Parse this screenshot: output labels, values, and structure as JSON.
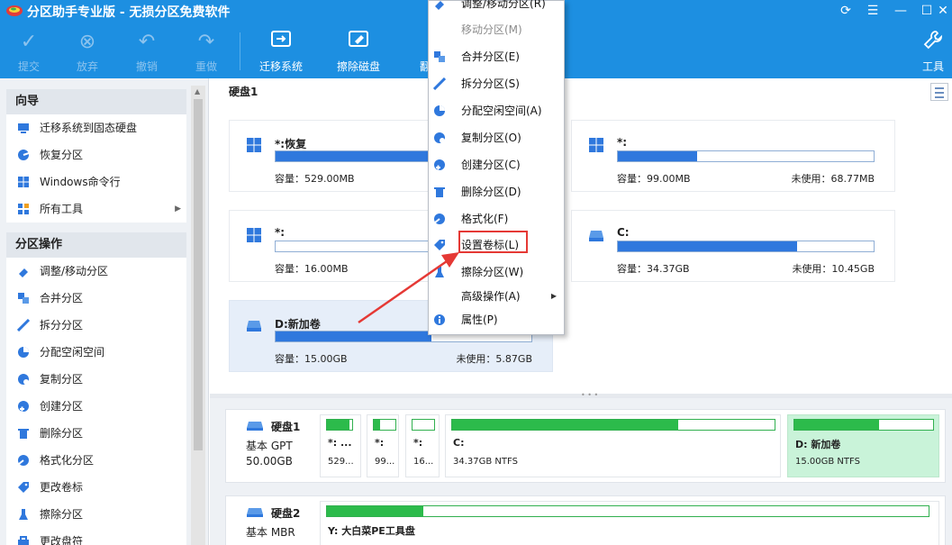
{
  "app": {
    "title": "分区助手专业版 - 无损分区免费软件"
  },
  "toolbar": {
    "buttons": [
      {
        "label": "提交",
        "icon": "check-icon",
        "enabled": false
      },
      {
        "label": "放弃",
        "icon": "cancel-circle-icon",
        "enabled": false
      },
      {
        "label": "撤销",
        "icon": "undo-icon",
        "enabled": false
      },
      {
        "label": "重做",
        "icon": "redo-icon",
        "enabled": false
      },
      {
        "label": "迁移系统",
        "icon": "migrate-os-icon",
        "enabled": true
      },
      {
        "label": "擦除磁盘",
        "icon": "wipe-disk-icon",
        "enabled": true
      },
      {
        "label": "工具",
        "icon": "wrench-icon",
        "enabled": true
      }
    ],
    "partial_label": "翻"
  },
  "sidebar": {
    "wizard_heading": "向导",
    "wizard_items": [
      {
        "label": "迁移系统到固态硬盘",
        "icon": "migrate-icon"
      },
      {
        "label": "恢复分区",
        "icon": "recover-icon"
      },
      {
        "label": "Windows命令行",
        "icon": "windows-icon"
      },
      {
        "label": "所有工具",
        "icon": "grid-icon",
        "has_submenu": true
      }
    ],
    "ops_heading": "分区操作",
    "ops_items": [
      {
        "label": "调整/移动分区",
        "icon": "resize-icon"
      },
      {
        "label": "合并分区",
        "icon": "merge-icon"
      },
      {
        "label": "拆分分区",
        "icon": "split-icon"
      },
      {
        "label": "分配空闲空间",
        "icon": "allocate-icon"
      },
      {
        "label": "复制分区",
        "icon": "copy-icon"
      },
      {
        "label": "创建分区",
        "icon": "create-icon"
      },
      {
        "label": "删除分区",
        "icon": "delete-icon"
      },
      {
        "label": "格式化分区",
        "icon": "format-icon"
      },
      {
        "label": "更改卷标",
        "icon": "label-icon"
      },
      {
        "label": "擦除分区",
        "icon": "wipe-icon"
      },
      {
        "label": "更改盘符",
        "icon": "letter-icon"
      }
    ]
  },
  "disk_view": {
    "title": "硬盘1",
    "partitions": [
      {
        "name": "*:恢复",
        "capacity": "容量：529.00MB",
        "free": "",
        "fill": 0.9
      },
      {
        "name": "*:",
        "capacity": "容量：99.00MB",
        "free": "未使用：68.77MB",
        "fill": 0.31
      },
      {
        "name": "*:",
        "capacity": "容量：16.00MB",
        "free": "",
        "fill": 0.0
      },
      {
        "name": "C:",
        "capacity": "容量：34.37GB",
        "free": "未使用：10.45GB",
        "fill": 0.7
      },
      {
        "name": "D:新加卷",
        "capacity": "容量：15.00GB",
        "free": "未使用：5.87GB",
        "fill": 0.61,
        "selected": true
      }
    ]
  },
  "disk_map": {
    "disks": [
      {
        "name": "硬盘1",
        "type": "基本 GPT",
        "size": "50.00GB",
        "parts": [
          {
            "name": "*: ...",
            "desc": "529...",
            "fill": 0.9
          },
          {
            "name": "*:",
            "desc": "99...",
            "fill": 0.31
          },
          {
            "name": "*:",
            "desc": "16...",
            "fill": 0.0
          },
          {
            "name": "C:",
            "desc": "34.37GB NTFS",
            "fill": 0.7
          },
          {
            "name": "D: 新加卷",
            "desc": "15.00GB NTFS",
            "fill": 0.61,
            "selected": true
          }
        ]
      },
      {
        "name": "硬盘2",
        "type": "基本 MBR",
        "size": "",
        "parts": [
          {
            "name": "Y: 大白菜PE工具盘",
            "desc": "",
            "fill": 0.16
          }
        ]
      }
    ]
  },
  "context_menu": {
    "items": [
      {
        "label": "调整/移动分区(R)",
        "icon": "resize-icon",
        "enabled": true
      },
      {
        "label": "移动分区(M)",
        "icon": "",
        "enabled": false
      },
      {
        "label": "合并分区(E)",
        "icon": "merge-icon",
        "enabled": true
      },
      {
        "label": "拆分分区(S)",
        "icon": "split-icon",
        "enabled": true
      },
      {
        "label": "分配空闲空间(A)",
        "icon": "allocate-icon",
        "enabled": true
      },
      {
        "label": "复制分区(O)",
        "icon": "copy-icon",
        "enabled": true
      },
      {
        "label": "创建分区(C)",
        "icon": "create-icon",
        "enabled": true
      },
      {
        "label": "删除分区(D)",
        "icon": "delete-icon",
        "enabled": true
      },
      {
        "label": "格式化(F)",
        "icon": "format-icon",
        "enabled": true
      },
      {
        "label": "设置卷标(L)",
        "icon": "label-icon",
        "enabled": true,
        "highlighted": true
      },
      {
        "label": "擦除分区(W)",
        "icon": "wipe-icon",
        "enabled": true
      },
      {
        "label": "高级操作(A)",
        "icon": "",
        "enabled": true,
        "has_submenu": true
      },
      {
        "label": "属性(P)",
        "icon": "info-icon",
        "enabled": true
      }
    ]
  },
  "colors": {
    "toolbar_bg": "#1d8fe1",
    "bar_blue": "#2f78dd",
    "bar_green": "#2cbb4b",
    "selected_bg": "#c9f3d9",
    "highlight_red": "#e53935"
  }
}
